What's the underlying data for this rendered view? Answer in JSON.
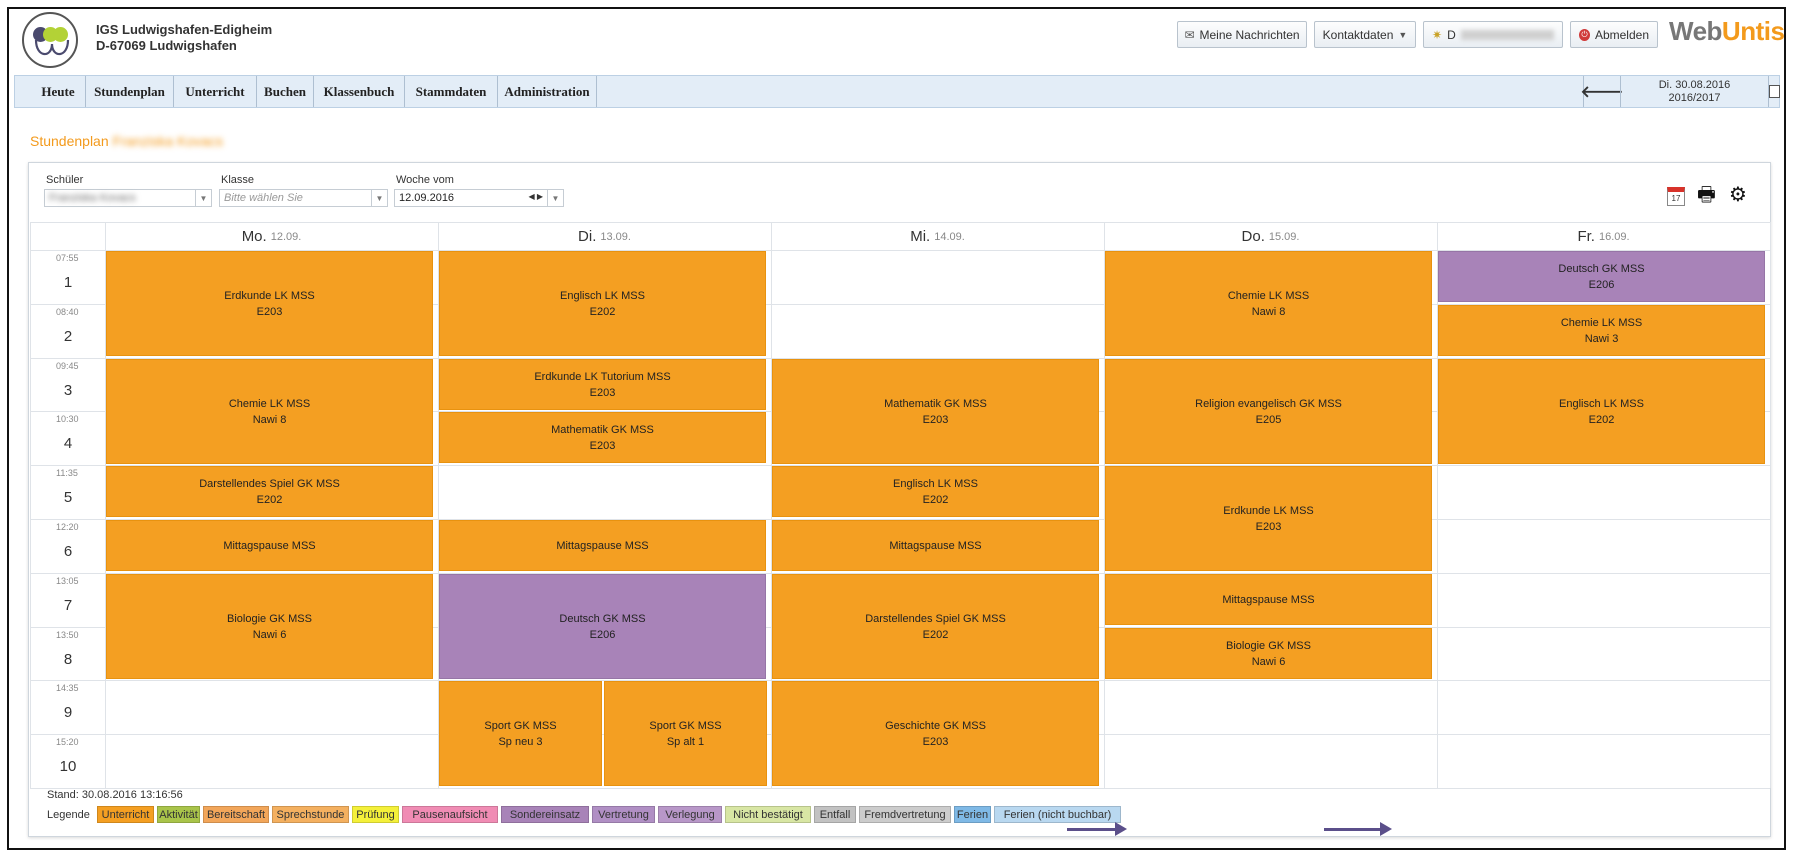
{
  "header": {
    "school_line1": "IGS Ludwigshafen-Edigheim",
    "school_line2": "D-67069 Ludwigshafen",
    "messages_label": "Meine Nachrichten",
    "contact_label": "Kontaktdaten",
    "user_label": "D",
    "logout_label": "Abmelden",
    "brand_web": "Web",
    "brand_untis": "Untis"
  },
  "nav": {
    "items": [
      "Heute",
      "Stundenplan",
      "Unterricht",
      "Buchen",
      "Klassenbuch",
      "Stammdaten",
      "Administration"
    ],
    "date": "Di. 30.08.2016",
    "school_year": "2016/2017"
  },
  "page": {
    "title": "Stundenplan",
    "title_name": "Franziska Kovacs"
  },
  "filters": {
    "student_label": "Schüler",
    "student_value": "Franziska Kovacs",
    "class_label": "Klasse",
    "class_placeholder": "Bitte wählen Sie",
    "week_label": "Woche vom",
    "week_value": "12.09.2016"
  },
  "days": [
    {
      "name": "Mo.",
      "date": "12.09."
    },
    {
      "name": "Di.",
      "date": "13.09."
    },
    {
      "name": "Mi.",
      "date": "14.09."
    },
    {
      "name": "Do.",
      "date": "15.09."
    },
    {
      "name": "Fr.",
      "date": "16.09."
    }
  ],
  "periods": [
    {
      "num": "1",
      "time": "07:55"
    },
    {
      "num": "2",
      "time": "08:40"
    },
    {
      "num": "3",
      "time": "09:45"
    },
    {
      "num": "4",
      "time": "10:30"
    },
    {
      "num": "5",
      "time": "11:35"
    },
    {
      "num": "6",
      "time": "12:20"
    },
    {
      "num": "7",
      "time": "13:05"
    },
    {
      "num": "8",
      "time": "13:50"
    },
    {
      "num": "9",
      "time": "14:35"
    },
    {
      "num": "10",
      "time": "15:20"
    }
  ],
  "lessons": [
    {
      "subject": "Erdkunde LK MSS",
      "room": "E203"
    },
    {
      "subject": "Chemie LK MSS",
      "room": "Nawi 8"
    },
    {
      "subject": "Darstellendes Spiel GK MSS",
      "room": "E202"
    },
    {
      "subject": "Mittagspause MSS",
      "room": ""
    },
    {
      "subject": "Biologie GK MSS",
      "room": "Nawi 6"
    },
    {
      "subject": "Englisch LK MSS",
      "room": "E202"
    },
    {
      "subject": "Erdkunde LK Tutorium MSS",
      "room": "E203"
    },
    {
      "subject": "Mathematik GK MSS",
      "room": "E203"
    },
    {
      "subject": "Mittagspause MSS",
      "room": ""
    },
    {
      "subject": "Deutsch GK MSS",
      "room": "E206"
    },
    {
      "subject": "Sport GK MSS",
      "room": "Sp neu 3"
    },
    {
      "subject": "Sport GK MSS",
      "room": "Sp alt 1"
    },
    {
      "subject": "Mathematik GK MSS",
      "room": "E203"
    },
    {
      "subject": "Englisch LK MSS",
      "room": "E202"
    },
    {
      "subject": "Mittagspause MSS",
      "room": ""
    },
    {
      "subject": "Darstellendes Spiel GK MSS",
      "room": "E202"
    },
    {
      "subject": "Geschichte GK MSS",
      "room": "E203"
    },
    {
      "subject": "Chemie LK MSS",
      "room": "Nawi 8"
    },
    {
      "subject": "Religion evangelisch GK MSS",
      "room": "E205"
    },
    {
      "subject": "Erdkunde LK MSS",
      "room": "E203"
    },
    {
      "subject": "Mittagspause MSS",
      "room": ""
    },
    {
      "subject": "Biologie GK MSS",
      "room": "Nawi 6"
    },
    {
      "subject": "Deutsch GK MSS",
      "room": "E206"
    },
    {
      "subject": "Chemie LK MSS",
      "room": "Nawi 3"
    },
    {
      "subject": "Englisch LK MSS",
      "room": "E202"
    }
  ],
  "footer": {
    "stand": "Stand: 30.08.2016 13:16:56",
    "legend_label": "Legende"
  },
  "legend": [
    {
      "label": "Unterricht",
      "color": "#f49f22"
    },
    {
      "label": "Aktivität",
      "color": "#a9c44a"
    },
    {
      "label": "Bereitschaft",
      "color": "#f2a65a"
    },
    {
      "label": "Sprechstunde",
      "color": "#f4b060"
    },
    {
      "label": "Prüfung",
      "color": "#f4f03a"
    },
    {
      "label": "Pausenaufsicht",
      "color": "#f08cb4"
    },
    {
      "label": "Sondereinsatz",
      "color": "#a883b8"
    },
    {
      "label": "Vertretung",
      "color": "#b08fc4"
    },
    {
      "label": "Verlegung",
      "color": "#b897c8"
    },
    {
      "label": "Nicht bestätigt",
      "color": "#d8e6a4"
    },
    {
      "label": "Entfall",
      "color": "#c2c2c2"
    },
    {
      "label": "Fremdvertretung",
      "color": "#cccccc"
    },
    {
      "label": "Ferien",
      "color": "#7fb9e6"
    },
    {
      "label": "Ferien (nicht buchbar)",
      "color": "#b9d8f0"
    }
  ]
}
